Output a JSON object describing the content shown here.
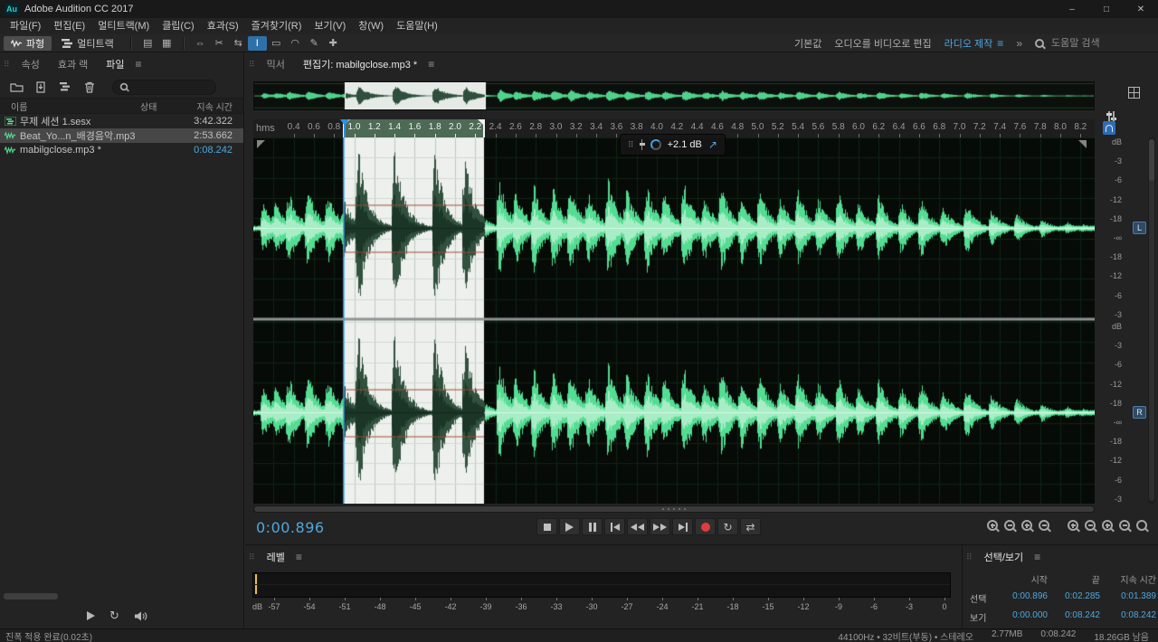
{
  "titlebar": {
    "logo": "Au",
    "title": "Adobe Audition CC 2017"
  },
  "icons": {
    "panel_menu": "≡",
    "overflow": "»",
    "grip": "⠿",
    "minimize": "–",
    "maximize": "□",
    "close": "✕",
    "loop": "↻",
    "skip_selection": "⇄",
    "hud_pin": "↗"
  },
  "menubar": {
    "items": [
      "파일(F)",
      "편집(E)",
      "멀티트랙(M)",
      "클립(C)",
      "효과(S)",
      "즐겨찾기(R)",
      "보기(V)",
      "창(W)",
      "도움말(H)"
    ]
  },
  "toolbar": {
    "waveform_label": "파형",
    "multitrack_label": "멀티트랙",
    "display_icon_glyphs": [
      "▤",
      "▦"
    ],
    "display_icon_names": [
      "spectral-frequency-display",
      "spectral-pitch-display"
    ],
    "tool_glyphs": [
      "⇔",
      "✂",
      "⇆",
      "I",
      "▭",
      "◠",
      "✎",
      "✚"
    ],
    "tool_names": [
      "move",
      "razor",
      "slip",
      "time-selection",
      "marquee-selection",
      "lasso-selection",
      "paintbrush-selection",
      "spot-healing-brush"
    ],
    "active_tool_index": 3,
    "workspaces": [
      "기본값",
      "오디오를 비디오로 편집",
      "라디오 제작"
    ],
    "active_workspace": "라디오 제작",
    "search_placeholder": "도움말 검색"
  },
  "files_panel": {
    "tabs": [
      "속성",
      "효과 랙",
      "파일"
    ],
    "active_tab": "파일",
    "columns": [
      "이름",
      "상태",
      "지속 시간"
    ],
    "rows": [
      {
        "name": "무제 세션 1.sesx",
        "type": "session",
        "duration": "3:42.322",
        "selected": false
      },
      {
        "name": "Beat_Yo...n_배경음악.mp3",
        "type": "audio",
        "duration": "2:53.662",
        "selected": true
      },
      {
        "name": "mabilgclose.mp3 *",
        "type": "audio",
        "duration": "0:08.242",
        "selected": false,
        "open_in_editor": true
      }
    ]
  },
  "editor": {
    "tabs": [
      "믹서",
      "편집기: mabilgclose.mp3 *"
    ],
    "active_tab": "편집기: mabilgclose.mp3 *",
    "ruler_unit_label": "hms",
    "ruler": {
      "first_label_s": 0.4,
      "last_label_s": 8.2,
      "step_s": 0.2
    },
    "hud": {
      "gain_label": "+2.1 dB"
    },
    "db_scale_labels": [
      "dB",
      "-3",
      "-6",
      "-12",
      "-18",
      "-∞",
      "-18",
      "-12",
      "-6",
      "-3"
    ],
    "channel_labels": [
      "L",
      "R"
    ],
    "time_display": "0:00.896",
    "selection_s": {
      "start": 0.896,
      "end": 2.285
    },
    "view_s": {
      "start": 0.0,
      "end": 8.35
    },
    "file_duration_s": 8.242
  },
  "waveform": {
    "color": "#53dd92",
    "selection_color": "#31513e",
    "beats": [
      [
        0.08,
        0.3
      ],
      [
        0.2,
        0.35
      ],
      [
        0.33,
        0.45
      ],
      [
        0.52,
        0.5
      ],
      [
        0.72,
        0.45
      ],
      [
        0.88,
        0.35
      ],
      [
        1.02,
        0.97
      ],
      [
        1.38,
        1.0
      ],
      [
        1.78,
        0.97
      ],
      [
        2.08,
        0.9
      ],
      [
        2.42,
        0.62
      ],
      [
        2.58,
        0.5
      ],
      [
        2.76,
        0.58
      ],
      [
        2.95,
        0.52
      ],
      [
        3.12,
        0.6
      ],
      [
        3.3,
        0.48
      ],
      [
        3.5,
        0.62
      ],
      [
        3.68,
        0.5
      ],
      [
        3.88,
        0.55
      ],
      [
        4.05,
        0.45
      ],
      [
        4.25,
        0.58
      ],
      [
        4.45,
        0.42
      ],
      [
        4.62,
        0.55
      ],
      [
        4.82,
        0.45
      ],
      [
        5.0,
        0.5
      ],
      [
        5.2,
        0.4
      ],
      [
        5.38,
        0.48
      ],
      [
        5.58,
        0.38
      ],
      [
        5.78,
        0.45
      ],
      [
        5.98,
        0.35
      ],
      [
        6.18,
        0.42
      ],
      [
        6.4,
        0.32
      ],
      [
        6.6,
        0.38
      ],
      [
        6.82,
        0.28
      ],
      [
        7.05,
        0.32
      ],
      [
        7.3,
        0.24
      ],
      [
        7.55,
        0.18
      ],
      [
        7.8,
        0.12
      ],
      [
        8.05,
        0.08
      ],
      [
        8.2,
        0.05
      ]
    ]
  },
  "transport": {
    "buttons": [
      "stop",
      "play",
      "pause",
      "skip-previous",
      "rewind",
      "fast-forward",
      "skip-next",
      "record",
      "loop",
      "skip-selection"
    ]
  },
  "zoom_buttons": [
    "zoom-in-full",
    "zoom-out-full",
    "zoom-to-selection",
    "zoom-reset",
    "zoom-in-time",
    "zoom-out-time",
    "zoom-in-amplitude",
    "zoom-out-amplitude",
    "zoom-options"
  ],
  "levels_panel": {
    "title": "레벨",
    "db_label": "dB",
    "scale_min": -57,
    "scale_max": 0,
    "scale_step": 3
  },
  "selection_view_panel": {
    "title": "선택/보기",
    "columns": [
      "시작",
      "끝",
      "지속 시간"
    ],
    "rows": [
      {
        "label": "선택",
        "values": [
          "0:00.896",
          "0:02.285",
          "0:01.389"
        ]
      },
      {
        "label": "보기",
        "values": [
          "0:00.000",
          "0:08.242",
          "0:08.242"
        ]
      }
    ]
  },
  "statusbar": {
    "message": "진폭 적용 완료(0.02초)",
    "format": "44100Hz • 32비트(부동) • 스테레오",
    "file_size": "2.77MB",
    "total_duration": "0:08.242",
    "free_space": "18.26GB 남음"
  }
}
